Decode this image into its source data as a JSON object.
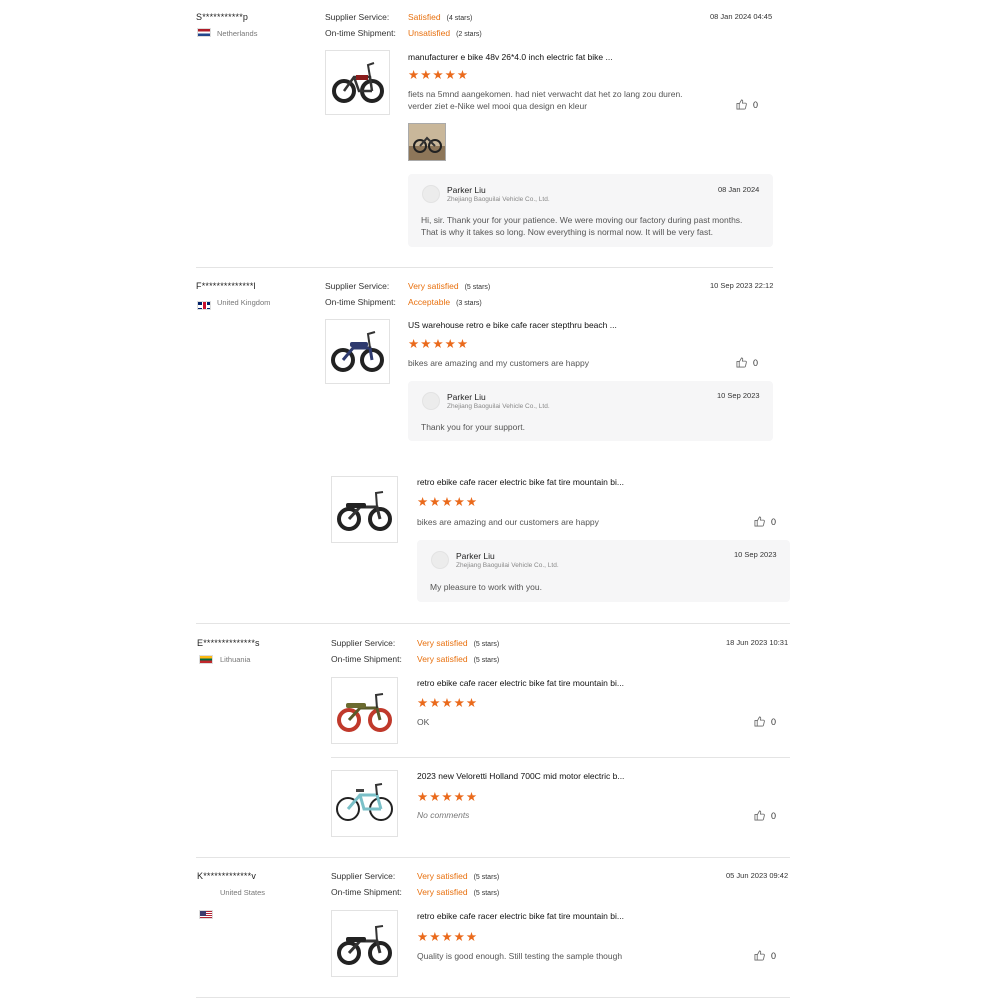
{
  "labels": {
    "supplier_service": "Supplier Service:",
    "ontime_shipment": "On-time Shipment:"
  },
  "reviews": [
    {
      "user": "S***********p",
      "country": "Netherlands",
      "supplier_rating": "Satisfied",
      "supplier_stars": "(4 stars)",
      "shipment_rating": "Unsatisfied",
      "shipment_stars": "(2 stars)",
      "date": "08 Jan 2024 04:45",
      "products": [
        {
          "title": "manufacturer e bike 48v 26*4.0 inch electric fat bike ...",
          "stars": "★★★★★",
          "comment": "fiets na 5mnd aangekomen. had niet verwacht dat het zo lang zou duren. verder ziet e-Nike wel mooi qua design en kleur",
          "likes": "0",
          "reply": {
            "name": "Parker Liu",
            "company": "Zhejiang Baoguilai Vehicle Co., Ltd.",
            "date": "08 Jan 2024",
            "text": "Hi, sir. Thank your for your patience. We were moving our factory during past months. That is why it takes so long. Now everything is normal now. It will be very fast."
          }
        }
      ]
    },
    {
      "user": "F**************l",
      "country": "United Kingdom",
      "supplier_rating": "Very satisfied",
      "supplier_stars": "(5 stars)",
      "shipment_rating": "Acceptable",
      "shipment_stars": "(3 stars)",
      "date": "10 Sep 2023 22:12",
      "products": [
        {
          "title": "US warehouse retro e bike cafe racer stepthru beach ...",
          "stars": "★★★★★",
          "comment": "bikes are amazing and my customers are happy",
          "likes": "0",
          "reply": {
            "name": "Parker Liu",
            "company": "Zhejiang Baoguilai Vehicle Co., Ltd.",
            "date": "10 Sep 2023",
            "text": "Thank you for your support."
          }
        },
        {
          "title": "retro ebike cafe racer electric bike fat tire mountain bi...",
          "stars": "★★★★★",
          "comment": "bikes are amazing and our customers are happy",
          "likes": "0",
          "reply": {
            "name": "Parker Liu",
            "company": "Zhejiang Baoguilai Vehicle Co., Ltd.",
            "date": "10 Sep 2023",
            "text": "My pleasure to work with you."
          }
        }
      ]
    },
    {
      "user": "E**************s",
      "country": "Lithuania",
      "supplier_rating": "Very satisfied",
      "supplier_stars": "(5 stars)",
      "shipment_rating": "Very satisfied",
      "shipment_stars": "(5 stars)",
      "date": "18 Jun 2023 10:31",
      "products": [
        {
          "title": "retro ebike cafe racer electric bike fat tire mountain bi...",
          "stars": "★★★★★",
          "comment": "OK",
          "likes": "0"
        },
        {
          "title": "2023 new Veloretti Holland 700C mid motor electric b...",
          "stars": "★★★★★",
          "comment": "No comments",
          "likes": "0"
        }
      ]
    },
    {
      "user": "K*************v",
      "country": "United States",
      "supplier_rating": "Very satisfied",
      "supplier_stars": "(5 stars)",
      "shipment_rating": "Very satisfied",
      "shipment_stars": "(5 stars)",
      "date": "05 Jun 2023 09:42",
      "products": [
        {
          "title": "retro ebike cafe racer electric bike fat tire mountain bi...",
          "stars": "★★★★★",
          "comment": "Quality is good enough. Still testing the sample though",
          "likes": "0"
        }
      ]
    }
  ],
  "colors": {
    "accent": "#ea6a1c",
    "rating_text": "#e8700e",
    "reply_bg": "#f6f6f7"
  },
  "icons": {
    "like": "thumbs-up-icon",
    "avatar": "avatar-icon"
  }
}
